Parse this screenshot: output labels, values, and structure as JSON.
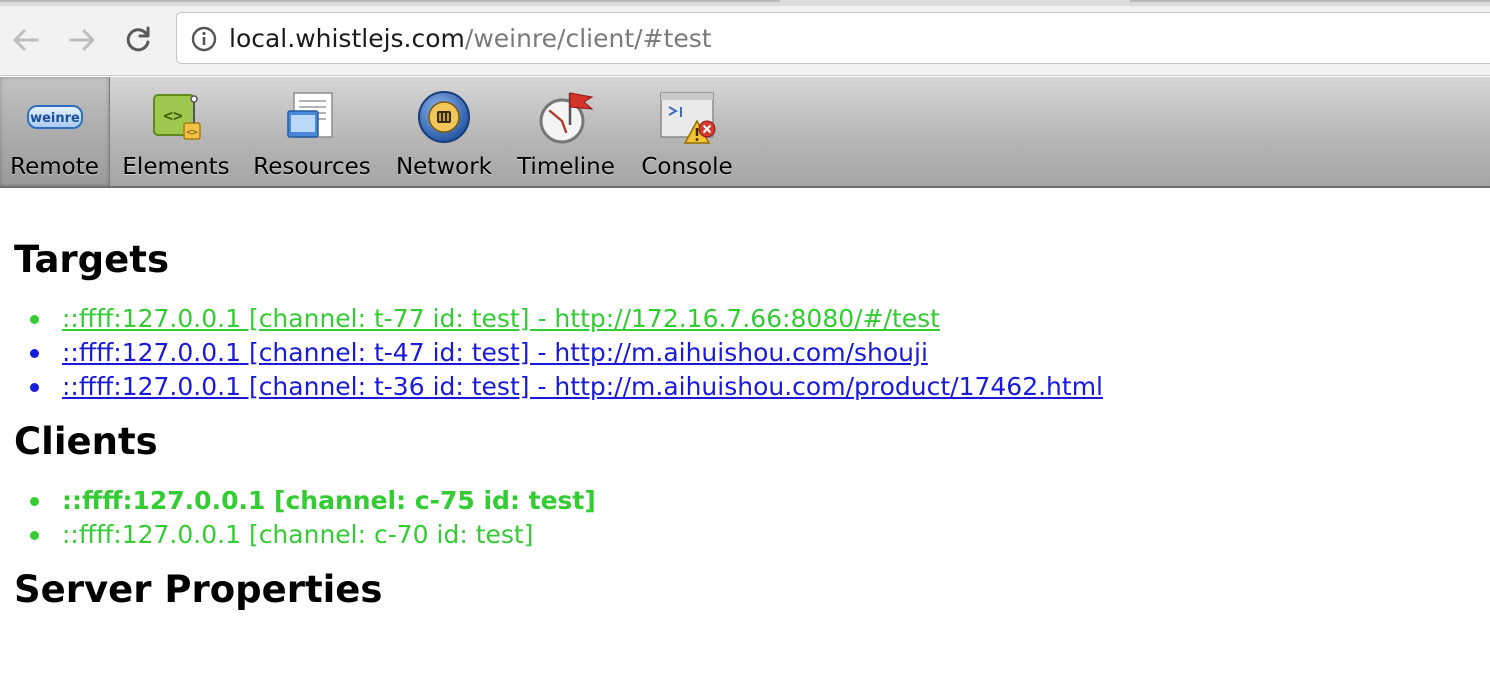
{
  "browser": {
    "url_host": "local.whistlejs.com",
    "url_path": "/weinre/client/#test",
    "back_icon": "back-arrow-icon",
    "forward_icon": "forward-arrow-icon",
    "reload_icon": "reload-icon",
    "info_icon": "info-icon"
  },
  "weinre_toolbar": {
    "tools": [
      {
        "label": "Remote",
        "icon": "weinre-logo-icon",
        "logo_text": "weinre",
        "selected": true
      },
      {
        "label": "Elements",
        "icon": "elements-icon"
      },
      {
        "label": "Resources",
        "icon": "resources-icon"
      },
      {
        "label": "Network",
        "icon": "network-icon"
      },
      {
        "label": "Timeline",
        "icon": "timeline-icon"
      },
      {
        "label": "Console",
        "icon": "console-icon"
      }
    ]
  },
  "targets": {
    "heading": "Targets",
    "items": [
      {
        "text": "::ffff:127.0.0.1 [channel: t-77 id: test] - http://172.16.7.66:8080/#/test",
        "state": "connected"
      },
      {
        "text": "::ffff:127.0.0.1 [channel: t-47 id: test] - http://m.aihuishou.com/shouji",
        "state": "available"
      },
      {
        "text": "::ffff:127.0.0.1 [channel: t-36 id: test] - http://m.aihuishou.com/product/17462.html",
        "state": "available"
      }
    ]
  },
  "clients": {
    "heading": "Clients",
    "items": [
      {
        "text": "::ffff:127.0.0.1 [channel: c-75 id: test]",
        "state": "current"
      },
      {
        "text": "::ffff:127.0.0.1 [channel: c-70 id: test]",
        "state": "other"
      }
    ]
  },
  "server_properties": {
    "heading": "Server Properties"
  },
  "colors": {
    "connected": "#33cc33",
    "link": "#1a1adb"
  }
}
